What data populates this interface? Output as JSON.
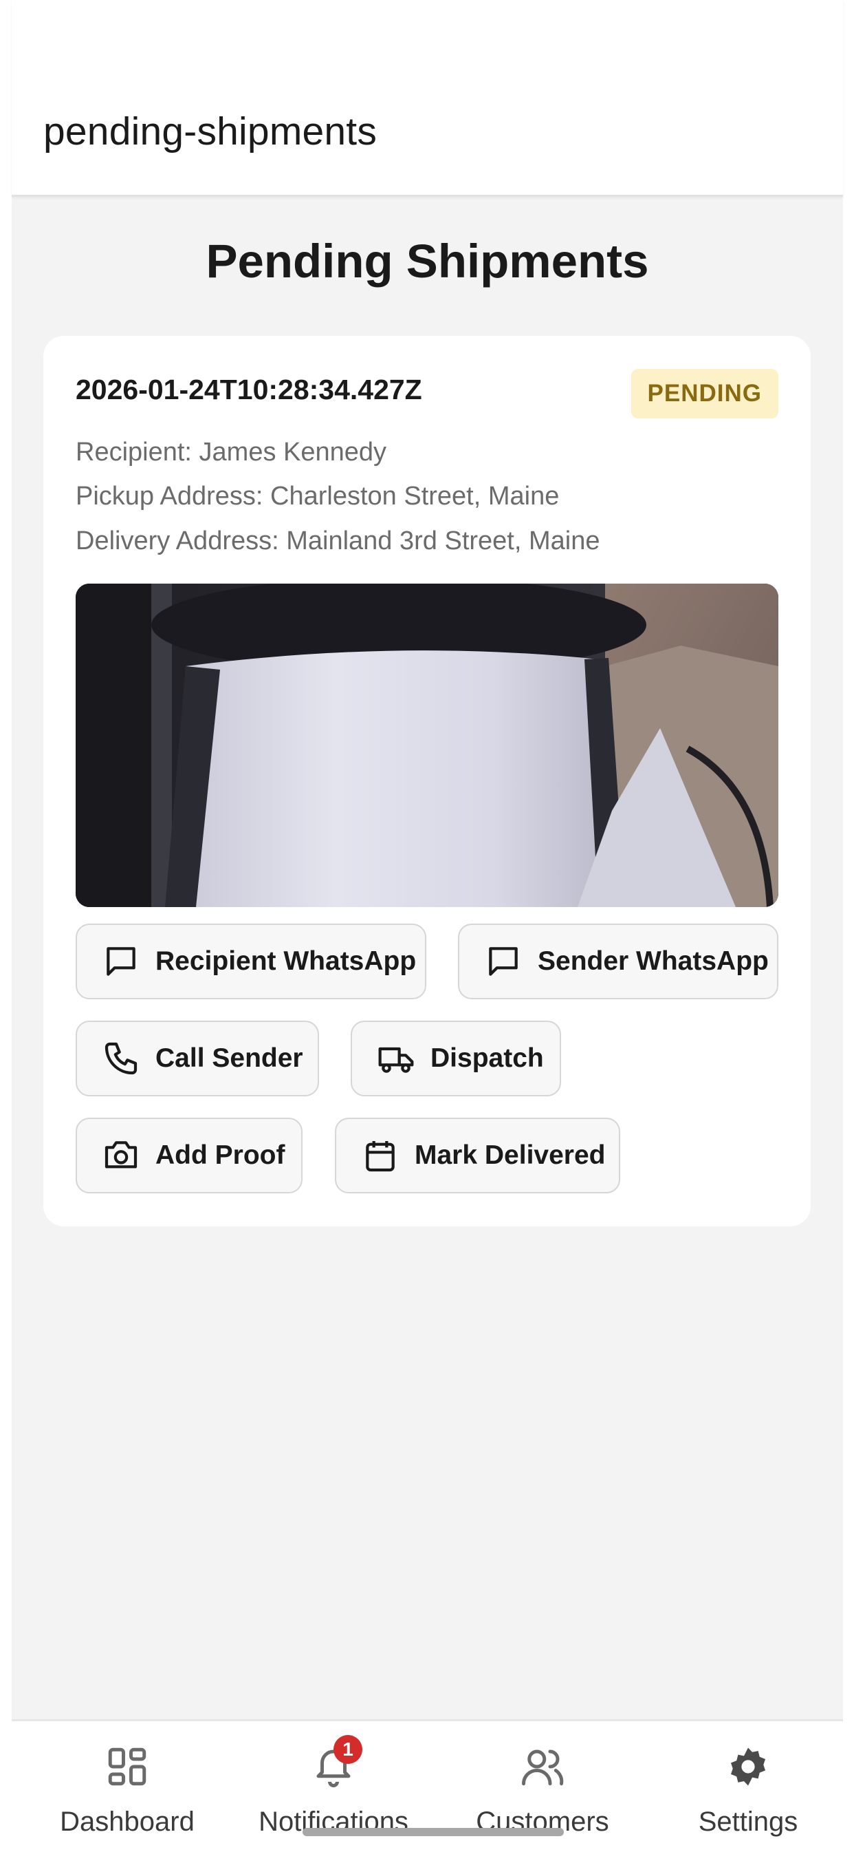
{
  "header": {
    "title": "pending-shipments"
  },
  "page": {
    "title": "Pending Shipments"
  },
  "shipment": {
    "timestamp": "2026-01-24T10:28:34.427Z",
    "status": "PENDING",
    "recipient": "Recipient: James Kennedy",
    "pickup": "Pickup Address: Charleston Street, Maine",
    "delivery": "Delivery Address: Mainland 3rd Street, Maine"
  },
  "actions": {
    "recipient_whatsapp": "Recipient WhatsApp",
    "sender_whatsapp": "Sender WhatsApp",
    "call_sender": "Call Sender",
    "dispatch": "Dispatch",
    "add_proof": "Add Proof",
    "mark_delivered": "Mark Delivered"
  },
  "nav": {
    "items": [
      {
        "label": "Dashboard",
        "icon": "grid-icon"
      },
      {
        "label": "Notifications",
        "icon": "bell-icon",
        "badge": "1"
      },
      {
        "label": "Customers",
        "icon": "users-icon"
      },
      {
        "label": "Settings",
        "icon": "gear-icon"
      }
    ]
  },
  "colors": {
    "badge_bg": "#fcf1c7",
    "badge_text": "#8a6a10",
    "notification_badge": "#d42b2b",
    "background": "#f3f3f3"
  }
}
